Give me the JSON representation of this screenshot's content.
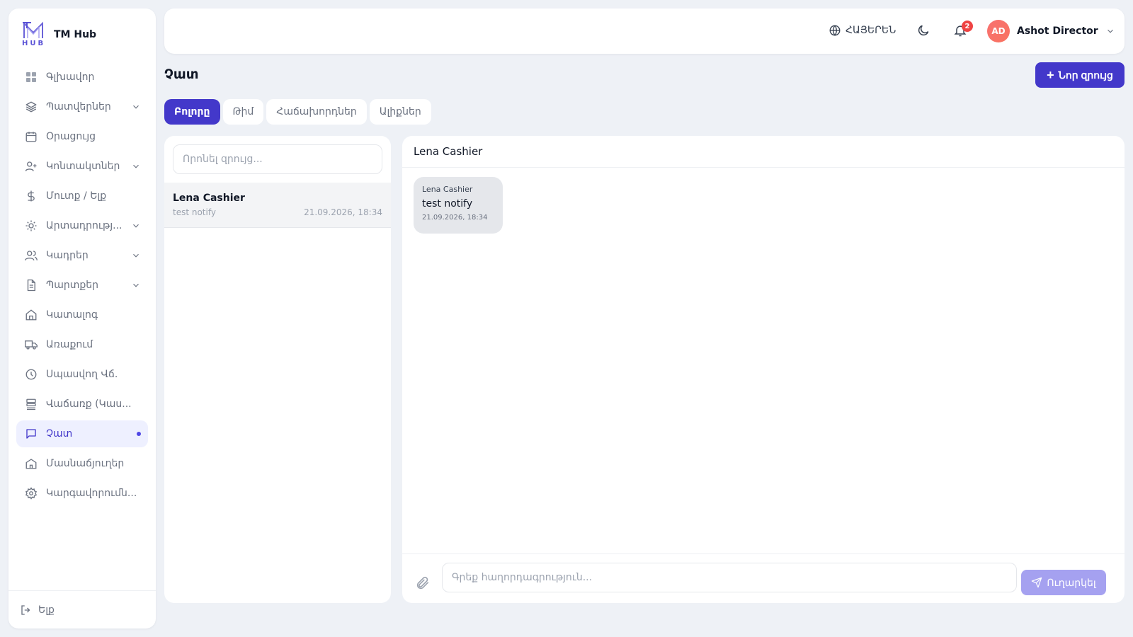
{
  "brand": {
    "name": "TM Hub",
    "logo_letters": "HUB"
  },
  "sidebar": {
    "items": [
      {
        "label": "Գլխավոր",
        "icon": "grid-icon",
        "has_chevron": false
      },
      {
        "label": "Պատվերներ",
        "icon": "layers-icon",
        "has_chevron": true
      },
      {
        "label": "Օրացույց",
        "icon": "calendar-icon",
        "has_chevron": false
      },
      {
        "label": "Կոնտակտներ",
        "icon": "user-plus-icon",
        "has_chevron": true
      },
      {
        "label": "Մուտք / Ելք",
        "icon": "dollar-icon",
        "has_chevron": false
      },
      {
        "label": "Արտադրությ...",
        "icon": "sun-icon",
        "has_chevron": true
      },
      {
        "label": "Կադրեր",
        "icon": "users-icon",
        "has_chevron": true
      },
      {
        "label": "Պարտքեր",
        "icon": "document-icon",
        "has_chevron": true
      },
      {
        "label": "Կատալոգ",
        "icon": "home-icon",
        "has_chevron": false
      },
      {
        "label": "Առաքում",
        "icon": "truck-icon",
        "has_chevron": false
      },
      {
        "label": "Սպասվող Վճ.",
        "icon": "clock-icon",
        "has_chevron": false
      },
      {
        "label": "Վաճառք (Կաս...",
        "icon": "server-icon",
        "has_chevron": false
      },
      {
        "label": "Չատ",
        "icon": "chat-icon",
        "has_chevron": false,
        "active": true
      },
      {
        "label": "Մասնաճյուղեր",
        "icon": "bank-icon",
        "has_chevron": false
      },
      {
        "label": "Կարգավորումն...",
        "icon": "gear-icon",
        "has_chevron": false
      }
    ],
    "logout_label": "Ելք"
  },
  "topbar": {
    "language": "ՀԱՅԵՐԵՆ",
    "notification_count": "2",
    "user_initials": "AD",
    "user_name": "Ashot Director"
  },
  "page": {
    "title": "Չատ",
    "new_button": "Նոր զրույց",
    "tabs": [
      {
        "label": "Բոլորը",
        "active": true
      },
      {
        "label": "Թիմ",
        "active": false
      },
      {
        "label": "Հաճախորդներ",
        "active": false
      },
      {
        "label": "Ալիքներ",
        "active": false
      }
    ]
  },
  "conversations": {
    "search_placeholder": "Որոնել զրույց...",
    "items": [
      {
        "name": "Lena Cashier",
        "preview": "test notify",
        "time": "21.09.2026, 18:34"
      }
    ]
  },
  "chat": {
    "title": "Lena Cashier",
    "messages": [
      {
        "author": "Lena Cashier",
        "text": "test notify",
        "time": "21.09.2026, 18:34"
      }
    ],
    "input_placeholder": "Գրեք հաղորդագրություն...",
    "send_label": "Ուղարկել"
  },
  "colors": {
    "accent": "#4338ca",
    "badge": "#ef4444",
    "avatar": "#f87171",
    "send_disabled": "#a5a1f0"
  }
}
